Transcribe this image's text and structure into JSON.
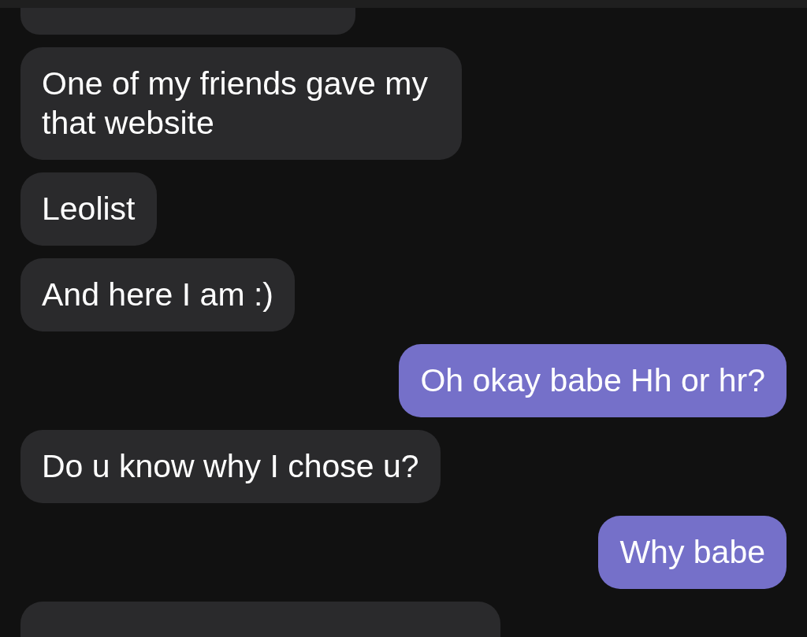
{
  "messages": [
    {
      "kind": "cut_top",
      "outgoing": false
    },
    {
      "kind": "message",
      "outgoing": false,
      "text": "One of my friends gave my that website"
    },
    {
      "kind": "message",
      "outgoing": false,
      "text": "Leolist"
    },
    {
      "kind": "message",
      "outgoing": false,
      "text": "And here I am :)"
    },
    {
      "kind": "message",
      "outgoing": true,
      "text": "Oh okay babe Hh or hr?"
    },
    {
      "kind": "message",
      "outgoing": false,
      "text": "Do u know why I chose u?"
    },
    {
      "kind": "message",
      "outgoing": true,
      "text": "Why babe"
    },
    {
      "kind": "cut_bottom",
      "outgoing": false
    }
  ]
}
